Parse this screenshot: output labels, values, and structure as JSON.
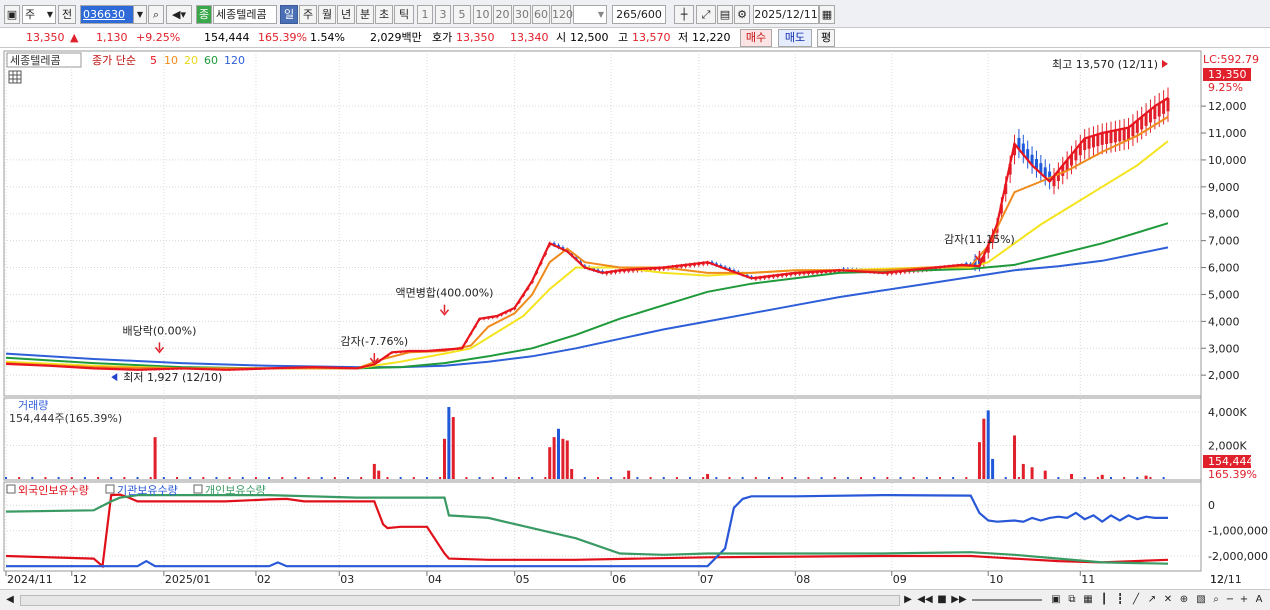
{
  "toolbar": {
    "market": "주",
    "prev_label": "전",
    "code": "036630",
    "name_badge": "종",
    "name": "세종텔레콤",
    "periods": [
      "일",
      "주",
      "월",
      "년",
      "분",
      "초",
      "틱"
    ],
    "active_period": "일",
    "ticks": [
      "1",
      "3",
      "5",
      "10",
      "20",
      "30",
      "60",
      "120"
    ],
    "count": "265",
    "count_total": "/600",
    "date": "2025/12/11"
  },
  "quote": {
    "price": "13,350",
    "change": "1,130",
    "change_pct": "+9.25%",
    "volume": "154,444",
    "vol_ratio": "165.39%",
    "turnover": "1.54%",
    "amount": "2,029백만",
    "hoga_label": "호가",
    "ask": "13,350",
    "bid": "13,340",
    "open_label": "시",
    "open": "12,500",
    "high_label": "고",
    "high": "13,570",
    "low_label": "저",
    "low": "12,220",
    "buy_label": "매수",
    "sell_label": "매도",
    "eval_label": "평"
  },
  "colors": {
    "ma5": "#e8141e",
    "ma10": "#ef8a1c",
    "ma20": "#f4e41e",
    "ma60": "#1f9a3a",
    "ma120": "#2e5fd8",
    "up": "#e0202a",
    "down": "#1f58d8",
    "foreign": "#e0101a",
    "institution": "#2858d8",
    "individual": "#3a9a64"
  },
  "chart_data": [
    {
      "type": "line",
      "title": "세종텔레콤",
      "legend": [
        "종가 단순",
        "5",
        "10",
        "20",
        "60",
        "120"
      ],
      "x_ticks": [
        "2024/11",
        "12",
        "2025/01",
        "02",
        "03",
        "04",
        "05",
        "06",
        "07",
        "08",
        "09",
        "10",
        "11",
        "12",
        "12/11"
      ],
      "y_ticks": [
        "2,000",
        "3,000",
        "4,000",
        "5,000",
        "6,000",
        "7,000",
        "8,000",
        "9,000",
        "10,000",
        "11,000",
        "12,000"
      ],
      "ylim": [
        1300,
        13900
      ],
      "right_labels": {
        "lc": "LC:592.79",
        "price": "13,350",
        "pct": "9.25%"
      },
      "series": [
        {
          "name": "5",
          "x": [
            0,
            10,
            20,
            30,
            40,
            50,
            60,
            70,
            80,
            84,
            88,
            92,
            96,
            100,
            104,
            108,
            112,
            116,
            120,
            124,
            128,
            132,
            136,
            140,
            150,
            160,
            170,
            180,
            190,
            200,
            206,
            212,
            218,
            222,
            226,
            230,
            234,
            238,
            242,
            246,
            250,
            256,
            262,
            265
          ],
          "values": [
            2420,
            2350,
            2250,
            2200,
            2250,
            2200,
            2250,
            2300,
            2250,
            2400,
            2850,
            2900,
            2900,
            2950,
            3000,
            4100,
            4200,
            4500,
            5500,
            6900,
            6600,
            6000,
            5800,
            5900,
            6000,
            6200,
            5600,
            5800,
            5900,
            5800,
            5900,
            6000,
            6100,
            6050,
            7600,
            10600,
            9800,
            9200,
            10000,
            10800,
            11000,
            11200,
            12000,
            12300
          ]
        },
        {
          "name": "10",
          "x": [
            0,
            20,
            40,
            60,
            80,
            86,
            92,
            100,
            106,
            110,
            116,
            120,
            124,
            128,
            132,
            140,
            150,
            160,
            170,
            180,
            190,
            200,
            210,
            220,
            224,
            230,
            236,
            242,
            250,
            258,
            265
          ],
          "values": [
            2450,
            2300,
            2250,
            2250,
            2250,
            2600,
            2850,
            2900,
            3100,
            3800,
            4300,
            5000,
            6200,
            6700,
            6200,
            6000,
            6000,
            5800,
            5800,
            5900,
            5900,
            5900,
            6000,
            6050,
            6800,
            8800,
            9200,
            9600,
            10300,
            10900,
            11600
          ]
        },
        {
          "name": "20",
          "x": [
            0,
            20,
            40,
            60,
            80,
            90,
            100,
            106,
            112,
            118,
            124,
            130,
            140,
            150,
            160,
            170,
            180,
            190,
            200,
            210,
            220,
            224,
            230,
            236,
            242,
            250,
            258,
            265
          ],
          "values": [
            2500,
            2350,
            2250,
            2250,
            2250,
            2500,
            2800,
            3000,
            3600,
            4200,
            5200,
            6000,
            6000,
            5800,
            5700,
            5800,
            5900,
            5900,
            5950,
            6000,
            6000,
            6200,
            6900,
            7600,
            8200,
            9000,
            9800,
            10700
          ]
        },
        {
          "name": "60",
          "x": [
            0,
            20,
            40,
            60,
            80,
            90,
            100,
            110,
            120,
            130,
            140,
            150,
            160,
            170,
            180,
            190,
            200,
            210,
            220,
            230,
            240,
            250,
            265
          ],
          "values": [
            2650,
            2450,
            2300,
            2250,
            2250,
            2300,
            2450,
            2700,
            3000,
            3500,
            4100,
            4600,
            5100,
            5400,
            5600,
            5800,
            5850,
            5900,
            5950,
            6100,
            6500,
            6900,
            7650
          ]
        },
        {
          "name": "120",
          "x": [
            0,
            20,
            40,
            60,
            80,
            90,
            100,
            110,
            120,
            130,
            140,
            150,
            160,
            170,
            180,
            190,
            200,
            210,
            220,
            230,
            240,
            250,
            265
          ],
          "values": [
            2800,
            2600,
            2450,
            2350,
            2300,
            2300,
            2350,
            2500,
            2700,
            3000,
            3350,
            3700,
            4000,
            4300,
            4600,
            4900,
            5150,
            5400,
            5650,
            5900,
            6050,
            6250,
            6750
          ]
        }
      ],
      "annotations": [
        {
          "text": "배당락(0.00%)",
          "x": 35,
          "y": 2700
        },
        {
          "text": "최저 1,927 (12/10)",
          "x": 24,
          "y": 1927
        },
        {
          "text": "감자(-7.76%)",
          "x": 84,
          "y": 2300
        },
        {
          "text": "액면병합(400.00%)",
          "x": 100,
          "y": 4100
        },
        {
          "text": "감자(11.15%)",
          "x": 222,
          "y": 6100
        },
        {
          "text": "최고 13,570 (12/11)",
          "x": 265,
          "y": 13570
        }
      ]
    },
    {
      "type": "bar",
      "title": "거래량",
      "summary": "154,444주(165.39%)",
      "y_ticks": [
        "2,000K",
        "4,000K"
      ],
      "ylim": [
        0,
        4600
      ],
      "right_labels": {
        "value": "154,444",
        "pct": "165.39%"
      },
      "values": [
        {
          "x": 34,
          "v": 2500,
          "up": true
        },
        {
          "x": 84,
          "v": 900,
          "up": true
        },
        {
          "x": 85,
          "v": 500,
          "up": true
        },
        {
          "x": 100,
          "v": 2400,
          "up": true
        },
        {
          "x": 101,
          "v": 4300,
          "up": false
        },
        {
          "x": 102,
          "v": 3700,
          "up": true
        },
        {
          "x": 124,
          "v": 1900,
          "up": true
        },
        {
          "x": 125,
          "v": 2500,
          "up": true
        },
        {
          "x": 126,
          "v": 3000,
          "up": false
        },
        {
          "x": 127,
          "v": 2400,
          "up": true
        },
        {
          "x": 128,
          "v": 2300,
          "up": true
        },
        {
          "x": 129,
          "v": 600,
          "up": true
        },
        {
          "x": 142,
          "v": 500,
          "up": true
        },
        {
          "x": 160,
          "v": 300,
          "up": true
        },
        {
          "x": 222,
          "v": 2200,
          "up": true
        },
        {
          "x": 223,
          "v": 3600,
          "up": true
        },
        {
          "x": 224,
          "v": 4100,
          "up": false
        },
        {
          "x": 225,
          "v": 1200,
          "up": false
        },
        {
          "x": 230,
          "v": 2600,
          "up": true
        },
        {
          "x": 232,
          "v": 900,
          "up": true
        },
        {
          "x": 234,
          "v": 700,
          "up": true
        },
        {
          "x": 237,
          "v": 500,
          "up": true
        },
        {
          "x": 243,
          "v": 300,
          "up": true
        },
        {
          "x": 250,
          "v": 250,
          "up": true
        },
        {
          "x": 260,
          "v": 200,
          "up": true
        }
      ]
    },
    {
      "type": "line",
      "legend": [
        "외국인보유수량",
        "기관보유수량",
        "개인보유수량"
      ],
      "y_ticks": [
        "0",
        "-1,000,000",
        "-2,000,000"
      ],
      "ylim": [
        -2550000,
        600000
      ],
      "series": [
        {
          "name": "외국인보유수량",
          "x": [
            0,
            20,
            22,
            24,
            26,
            28,
            30,
            50,
            56,
            60,
            64,
            68,
            84,
            86,
            87,
            90,
            96,
            100,
            101,
            110,
            130,
            160,
            200,
            220,
            225,
            230,
            240,
            250,
            265
          ],
          "values": [
            -2000000,
            -2100000,
            -2400000,
            400000,
            420000,
            300000,
            150000,
            150000,
            200000,
            230000,
            250000,
            150000,
            150000,
            -750000,
            -900000,
            -850000,
            -850000,
            -1900000,
            -2100000,
            -2150000,
            -2150000,
            -2050000,
            -2000000,
            -2000000,
            -2050000,
            -2100000,
            -2200000,
            -2250000,
            -2150000
          ]
        },
        {
          "name": "기관보유수량",
          "x": [
            0,
            10,
            20,
            30,
            32,
            34,
            40,
            60,
            62,
            64,
            70,
            80,
            100,
            120,
            160,
            164,
            166,
            168,
            170,
            180,
            200,
            220,
            222,
            224,
            226,
            230,
            232,
            234,
            236,
            238,
            240,
            242,
            244,
            246,
            248,
            250,
            252,
            254,
            256,
            258,
            260,
            262,
            265
          ],
          "values": [
            -2400000,
            -2400000,
            -2400000,
            -2400000,
            -2200000,
            -2400000,
            -2400000,
            -2400000,
            -2250000,
            -2400000,
            -2400000,
            -2400000,
            -2400000,
            -2400000,
            -2400000,
            -1700000,
            -100000,
            250000,
            350000,
            350000,
            400000,
            380000,
            -300000,
            -600000,
            -650000,
            -600000,
            -650000,
            -500000,
            -600000,
            -500000,
            -450000,
            -500000,
            -300000,
            -550000,
            -400000,
            -650000,
            -400000,
            -600000,
            -400000,
            -550000,
            -450000,
            -500000,
            -500000
          ]
        },
        {
          "name": "개인보유수량",
          "x": [
            0,
            20,
            24,
            26,
            30,
            40,
            60,
            80,
            100,
            101,
            110,
            130,
            140,
            150,
            160,
            170,
            200,
            220,
            230,
            240,
            250,
            265
          ],
          "values": [
            -250000,
            -200000,
            150000,
            300000,
            400000,
            400000,
            400000,
            300000,
            300000,
            -400000,
            -500000,
            -1300000,
            -1900000,
            -1950000,
            -1900000,
            -1900000,
            -1900000,
            -1850000,
            -1950000,
            -2100000,
            -2250000,
            -2300000
          ]
        }
      ]
    }
  ]
}
